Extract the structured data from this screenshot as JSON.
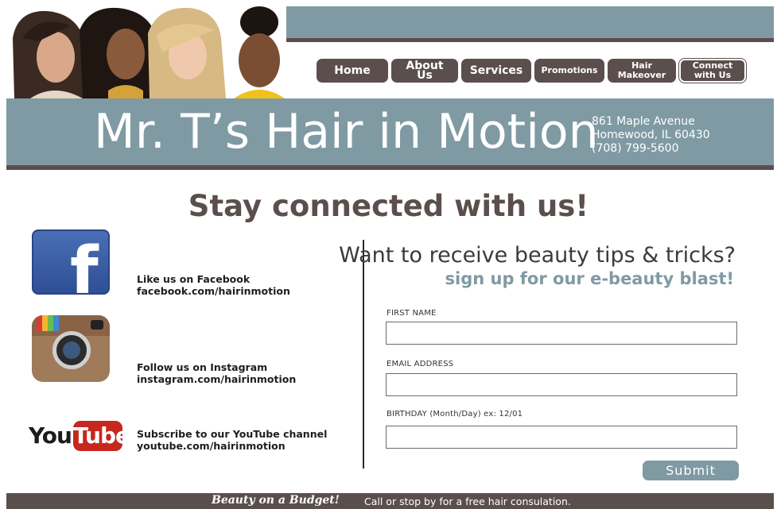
{
  "header": {
    "nav": [
      {
        "label": "Home"
      },
      {
        "label": "About Us"
      },
      {
        "label": "Services"
      },
      {
        "label": "Promotions"
      },
      {
        "label": "Hair\nMakeover"
      },
      {
        "label": "Connect\nwith Us"
      }
    ],
    "site_title": "Mr. T’s Hair in Motion",
    "address": {
      "street": "861 Maple Avenue",
      "city": "Homewood, IL 60430",
      "phone": "(708) 799-5600"
    }
  },
  "main": {
    "headline": "Stay connected with us!",
    "social": [
      {
        "icon": "facebook-icon",
        "line1": "Like us on Facebook",
        "line2": "facebook.com/hairinmotion"
      },
      {
        "icon": "instagram-icon",
        "line1": "Follow us on Instagram",
        "line2": "instagram.com/hairinmotion"
      },
      {
        "icon": "youtube-icon",
        "line1": "Subscribe to our YouTube channel",
        "line2": "youtube.com/hairinmotion",
        "logo_you": "You",
        "logo_tube": "Tube"
      }
    ],
    "facebook_logo_letter": "f",
    "form": {
      "title": "Want to receive beauty tips & tricks?",
      "subtitle": "sign up for our e-beauty blast!",
      "fields": [
        {
          "label": "FIRST NAME",
          "value": ""
        },
        {
          "label": "EMAIL ADDRESS",
          "value": ""
        },
        {
          "label": "BIRTHDAY (Month/Day) ex: 12/01",
          "value": ""
        }
      ],
      "submit_label": "Submit"
    }
  },
  "footer": {
    "slogan": "Beauty on a Budget!",
    "text": "Call or stop by for a free hair consulation."
  },
  "colors": {
    "brand_gray_blue": "#7f9aa3",
    "brand_brown": "#5b4f4d"
  }
}
